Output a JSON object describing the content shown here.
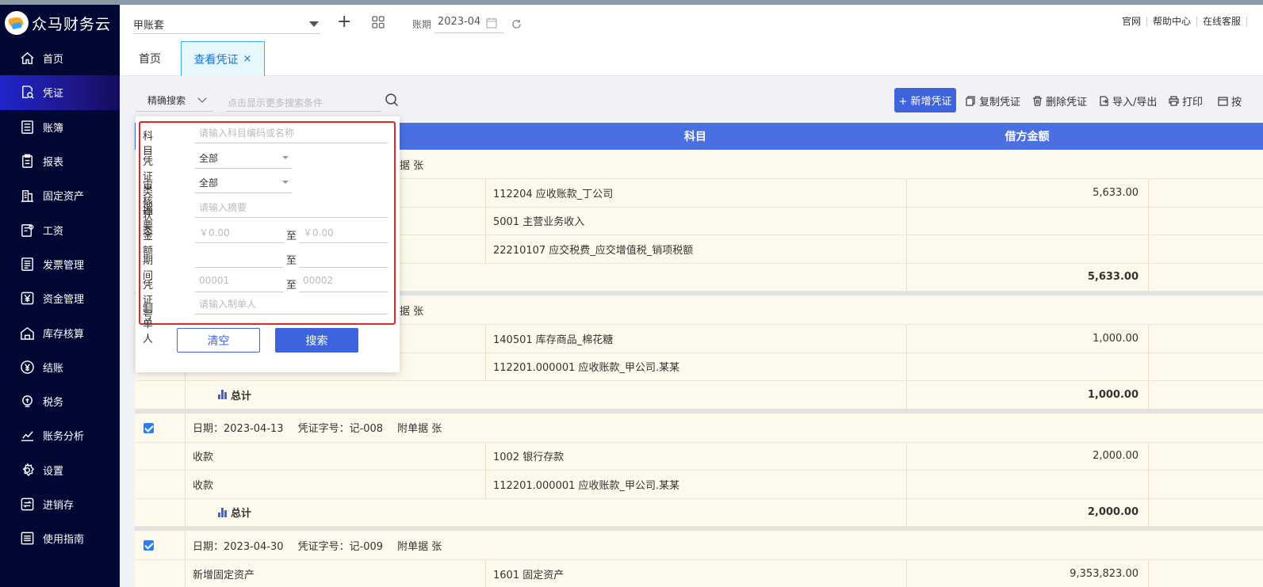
{
  "app": {
    "logo_text": "众马财务云"
  },
  "sidebar": {
    "items": [
      {
        "label": "首页",
        "icon": "home-icon"
      },
      {
        "label": "凭证",
        "icon": "voucher-search-icon",
        "active": true
      },
      {
        "label": "账簿",
        "icon": "ledger-icon"
      },
      {
        "label": "报表",
        "icon": "report-icon"
      },
      {
        "label": "固定资产",
        "icon": "building-icon"
      },
      {
        "label": "工资",
        "icon": "salary-icon"
      },
      {
        "label": "发票管理",
        "icon": "invoice-icon"
      },
      {
        "label": "资金管理",
        "icon": "yen-icon"
      },
      {
        "label": "库存核算",
        "icon": "warehouse-icon"
      },
      {
        "label": "结账",
        "icon": "settle-icon"
      },
      {
        "label": "税务",
        "icon": "tax-icon"
      },
      {
        "label": "账务分析",
        "icon": "chart-icon"
      },
      {
        "label": "设置",
        "icon": "gear-icon"
      },
      {
        "label": "进销存",
        "icon": "exchange-icon"
      },
      {
        "label": "使用指南",
        "icon": "guide-icon"
      }
    ]
  },
  "topbar": {
    "account": "甲账套",
    "period_label": "账期",
    "period_value": "2023-04",
    "links": [
      "官网",
      "帮助中心",
      "在线客服"
    ]
  },
  "tabs": {
    "home": "首页",
    "voucher": "查看凭证",
    "close": "×"
  },
  "toolbar": {
    "search_mode": "精确搜索",
    "search_placeholder": "点击显示更多搜索条件",
    "add": "+ 新增凭证",
    "copy": "复制凭证",
    "delete": "删除凭证",
    "import_export": "导入/导出",
    "print": "打印",
    "more": "按"
  },
  "table": {
    "headers": {
      "subject": "科目",
      "debit": "借方金额"
    }
  },
  "filter": {
    "subject_label": "科目",
    "subject_placeholder": "请输入科目编码或名称",
    "type_label": "凭证类型",
    "type_value": "全部",
    "audit_label": "审核状态",
    "audit_value": "全部",
    "summary_label": "摘要",
    "summary_placeholder": "请输入摘要",
    "amount_label": "金额",
    "amount_from": "￥0.00",
    "amount_to": "￥0.00",
    "period_label": "期间",
    "no_label": "凭证号",
    "no_from": "00001",
    "no_to": "00002",
    "maker_label": "制单人",
    "maker_placeholder": "请输入制单人",
    "to": "至",
    "clear": "清空",
    "search": "搜索"
  },
  "vouchers": [
    {
      "header_tail": "据  张",
      "lines": [
        {
          "summary": "",
          "subject": "112204  应收账款_丁公司",
          "debit": "5,633.00"
        },
        {
          "summary": "",
          "subject": "5001  主营业务收入",
          "debit": ""
        },
        {
          "summary": "",
          "subject": "22210107  应交税费_应交增值税_销项税额",
          "debit": ""
        }
      ],
      "total_label": "",
      "total": "5,633.00"
    },
    {
      "header_tail": "据  张",
      "lines": [
        {
          "summary": "",
          "subject": "140501  库存商品_棉花糖",
          "debit": "1,000.00"
        },
        {
          "summary": "",
          "subject": "112201.000001  应收账款_甲公司.某某",
          "debit": ""
        }
      ],
      "total_label": "总计",
      "total": "1,000.00"
    },
    {
      "date": "日期：2023-04-13",
      "no": "凭证字号：记-008",
      "attach": "附单据  张",
      "lines": [
        {
          "summary": "收款",
          "subject": "1002  银行存款",
          "debit": "2,000.00"
        },
        {
          "summary": "收款",
          "subject": "112201.000001  应收账款_甲公司.某某",
          "debit": ""
        }
      ],
      "total_label": "总计",
      "total": "2,000.00"
    },
    {
      "date": "日期：2023-04-30",
      "no": "凭证字号：记-009",
      "attach": "附单据  张",
      "lines": [
        {
          "summary": "新增固定资产",
          "subject": "1601  固定资产",
          "debit": "9,353,823.00"
        }
      ]
    }
  ]
}
